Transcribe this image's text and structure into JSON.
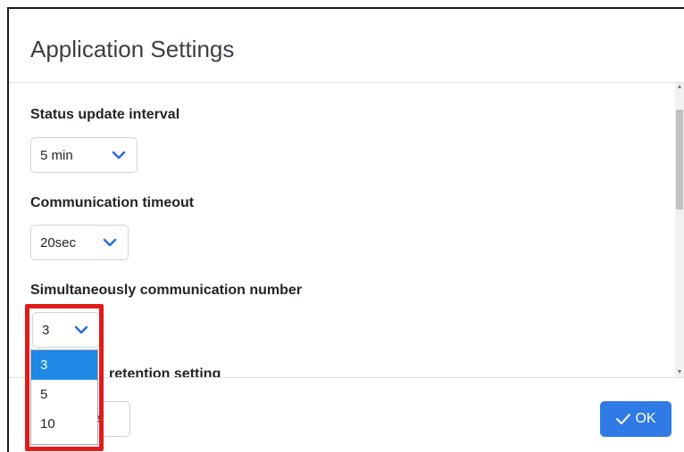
{
  "dialog": {
    "title": "Application Settings"
  },
  "settings": {
    "status_update_interval": {
      "label": "Status update interval",
      "value": "5 min"
    },
    "communication_timeout": {
      "label": "Communication timeout",
      "value": "20sec"
    },
    "simultaneous_number": {
      "label": "Simultaneously communication number",
      "value": "3",
      "options": [
        "3",
        "5",
        "10"
      ],
      "selected_option": "3"
    },
    "partially_visible_label": "retention setting"
  },
  "footer": {
    "cancel_label_visible": "el",
    "ok_label": "OK"
  },
  "colors": {
    "accent": "#2f7ae5",
    "highlight": "#e01b1b",
    "selected_option_bg": "#1e88e5"
  }
}
